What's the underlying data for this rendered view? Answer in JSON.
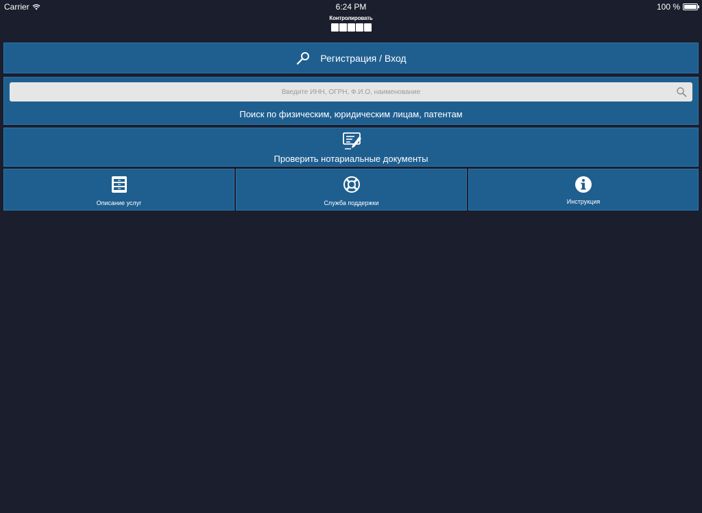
{
  "status_bar": {
    "carrier": "Carrier",
    "time": "6:24 PM",
    "battery": "100 %"
  },
  "logo": {
    "text": "Контролировать"
  },
  "login": {
    "label": "Регистрация / Вход",
    "icon": "key-icon"
  },
  "search": {
    "placeholder": "Введите ИНН, ОГРН, Ф.И.О, наименование",
    "caption": "Поиск по физическим, юридическим лицам, патентам",
    "icon": "search-icon"
  },
  "notary": {
    "label": "Проверить нотариальные документы",
    "icon": "document-pen-icon"
  },
  "tiles": [
    {
      "label": "Описание услуг",
      "icon": "cabinet-icon"
    },
    {
      "label": "Служба поддержки",
      "icon": "lifebuoy-icon"
    },
    {
      "label": "Инструкция",
      "icon": "info-icon"
    }
  ],
  "colors": {
    "background": "#1b1e2c",
    "panel": "#1f5f90",
    "panel_border": "#2c74aa",
    "search_field": "#e6e6e6",
    "text": "#ffffff"
  }
}
